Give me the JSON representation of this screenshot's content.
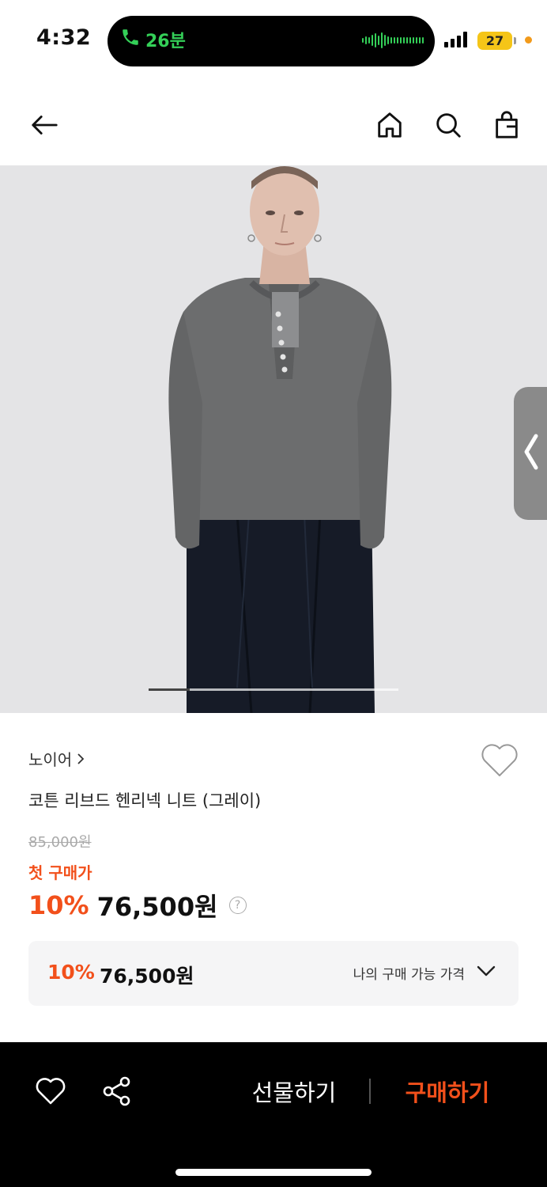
{
  "status_bar": {
    "time": "4:32",
    "call_duration": "26분",
    "battery": "27",
    "call_color": "#34d058",
    "battery_color": "#f5c518"
  },
  "nav": {
    "back_icon": "arrow-left-icon",
    "home_icon": "home-icon",
    "search_icon": "search-icon",
    "bag_icon": "shopping-bag-icon"
  },
  "product": {
    "brand": "노이어",
    "name": "코튼 리브드 헨리넥 니트 (그레이)",
    "original_price": "85,000원",
    "first_purchase_label": "첫 구매가",
    "discount": "10%",
    "price": "76,500원",
    "help_mark": "?",
    "image_page": 1,
    "image_page_count": 6
  },
  "price_box": {
    "discount": "10%",
    "price": "76,500원",
    "link_label": "나의 구매 가능 가격"
  },
  "bottom_bar": {
    "gift_label": "선물하기",
    "buy_label": "구매하기",
    "accent_color": "#f2501b"
  }
}
